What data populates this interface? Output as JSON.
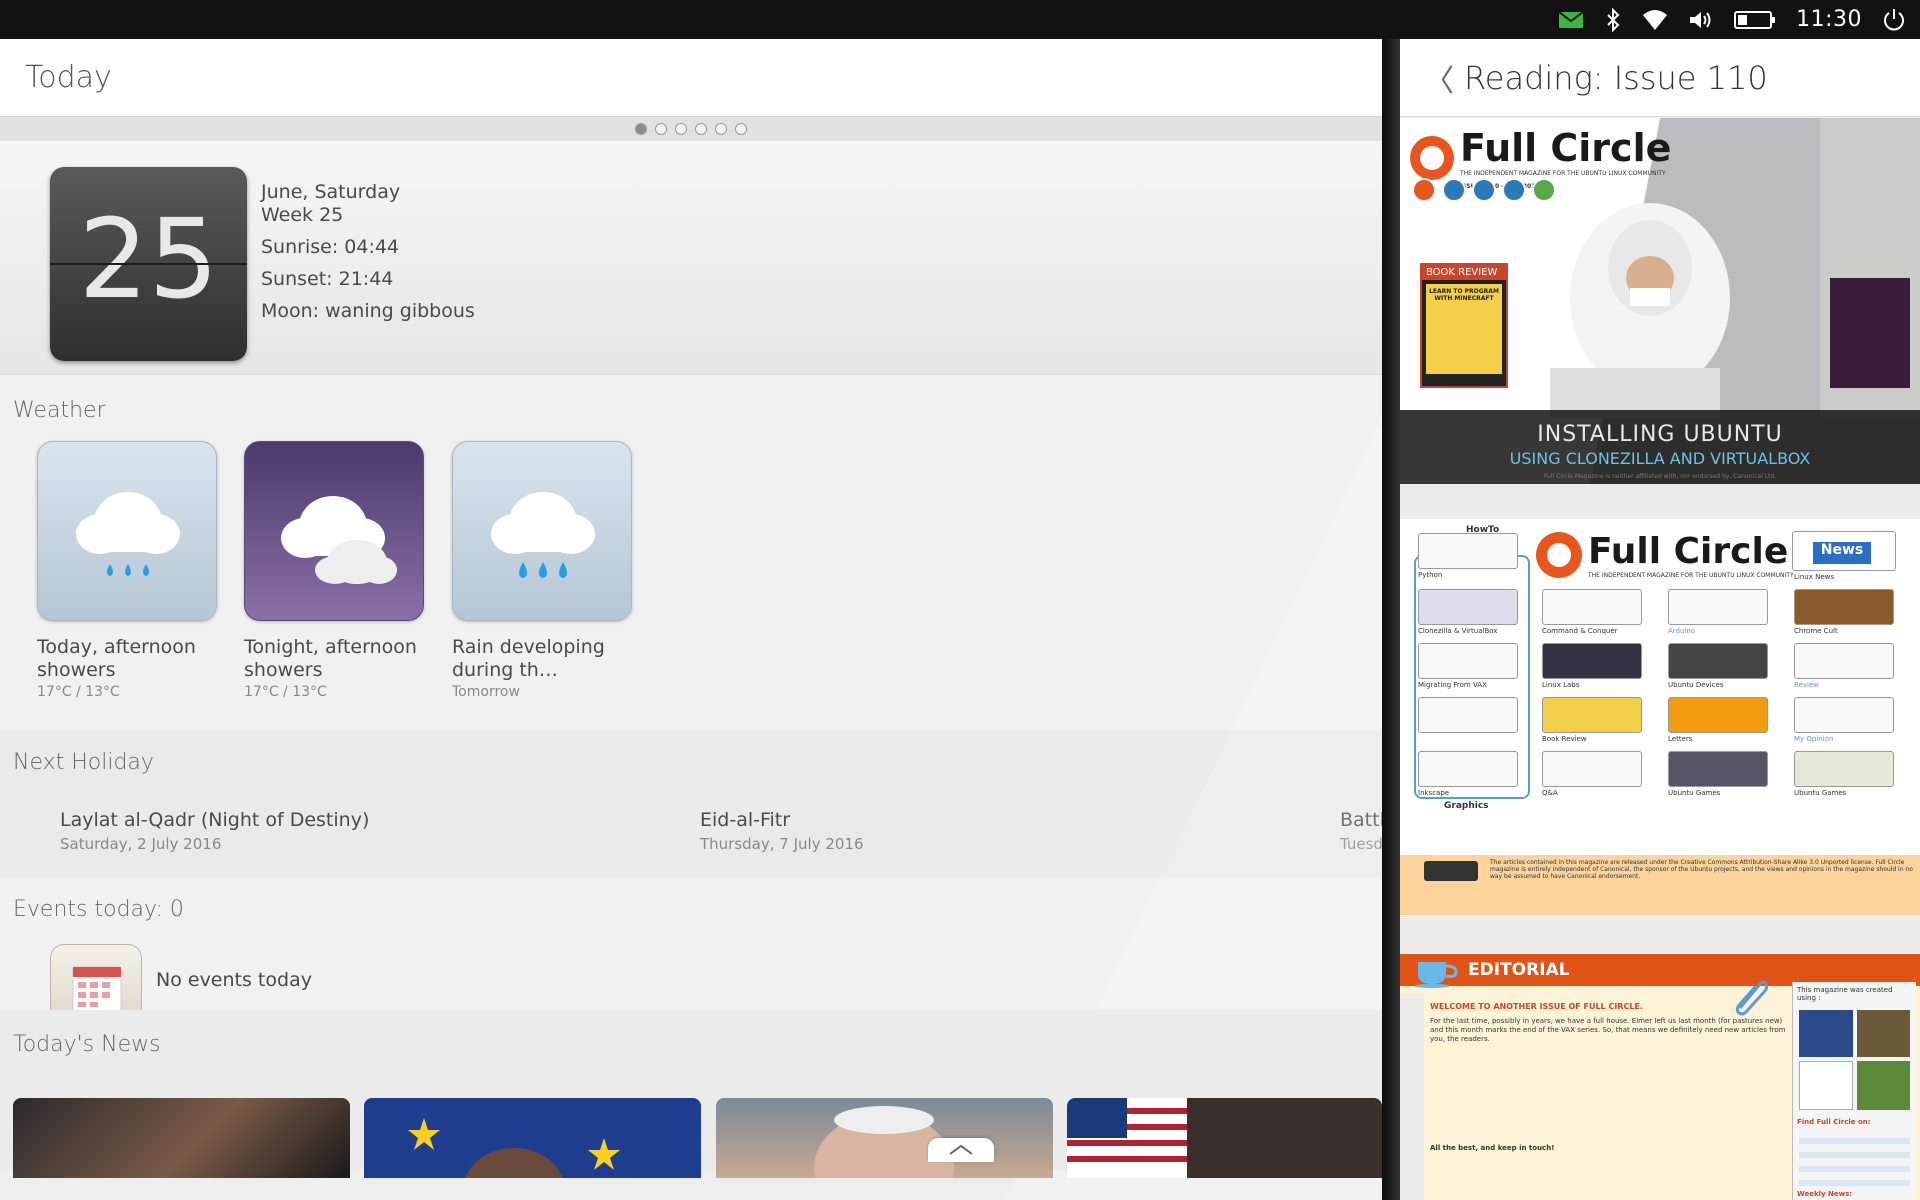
{
  "status": {
    "time": "11:30",
    "indicators": [
      "message-icon",
      "bluetooth-icon",
      "wifi-icon",
      "volume-icon",
      "battery-icon",
      "power-icon"
    ],
    "accent_message": "#3bb54a"
  },
  "today": {
    "title": "Today",
    "page_count": 6,
    "active_page": 0,
    "date": {
      "day_number": "25",
      "line1": "June, Saturday",
      "line2": "Week 25",
      "sunrise": "Sunrise: 04:44",
      "sunset": "Sunset: 21:44",
      "moon": "Moon: waning gibbous"
    },
    "weather": {
      "title": "Weather",
      "items": [
        {
          "icon": "rain-cloud-icon",
          "label": "Today, afternoon showers",
          "sub": "17°C / 13°C",
          "theme": "day"
        },
        {
          "icon": "cloud-icon",
          "label": "Tonight, afternoon showers",
          "sub": "17°C / 13°C",
          "theme": "night"
        },
        {
          "icon": "rain-cloud-icon",
          "label": "Rain developing during th…",
          "sub": "Tomorrow",
          "theme": "day"
        }
      ]
    },
    "holiday": {
      "title": "Next Holiday",
      "items": [
        {
          "name": "Laylat al-Qadr (Night of Destiny)",
          "date": "Saturday, 2 July 2016"
        },
        {
          "name": "Eid-al-Fitr",
          "date": "Thursday, 7 July 2016"
        },
        {
          "name": "Battle",
          "date": "Tuesday"
        }
      ]
    },
    "events": {
      "title": "Events today: 0",
      "empty": "No events today"
    },
    "news": {
      "title": "Today's News"
    }
  },
  "reader": {
    "back_label": "〈",
    "title": "Reading: Issue 110",
    "cover": {
      "magazine": "Full Circle",
      "tagline": "THE INDEPENDENT MAGAZINE FOR THE UBUNTU LINUX COMMUNITY",
      "issue": "ISSUE #110 - June 2016",
      "book_review": "BOOK REVIEW",
      "book_title": "LEARN TO PROGRAM WITH MINECRAFT",
      "headline": "INSTALLING UBUNTU",
      "subheadline": "USING CLONEZILLA AND VIRTUALBOX",
      "disclaimer": "Full Circle Magazine is neither affiliated with, nor endorsed by, Canonical Ltd."
    },
    "contents": {
      "magazine": "Full Circle",
      "tagline": "THE INDEPENDENT MAGAZINE FOR THE UBUNTU LINUX COMMUNITY",
      "howto": "HowTo",
      "graphics": "Graphics",
      "news": "News",
      "labels": [
        "Python",
        "Clonezilla & VirtualBox",
        "Migrating From VAX",
        "Inkscape",
        "Command & Conquer",
        "Linux Labs",
        "Book Review",
        "Q&A",
        "Arduino",
        "Ubuntu Devices",
        "Letters",
        "Ubuntu Games",
        "Linux News",
        "Chrome Cult",
        "Review",
        "My Opinion",
        "Ubuntu Games"
      ],
      "license": "The articles contained in this magazine are released under the Creative Commons Attribution-Share Alike 3.0 Unported license. Full Circle magazine is entirely independent of Canonical, the sponsor of the Ubuntu projects, and the views and opinions in the magazine should in no way be assumed to have Canonical endorsement."
    },
    "editorial": {
      "title": "EDITORIAL",
      "welcome": "WELCOME TO ANOTHER ISSUE OF FULL CIRCLE.",
      "body": "For the last time, possibly in years, we have a full house. Elmer left us last month (for pastures new) and this month marks the end of the VAX series. So, that means we definitely need new articles from you, the readers.",
      "signoff": "All the best, and keep in touch!",
      "created_using": "This magazine was created using :",
      "find": "Find Full Circle on:",
      "weekly": "Weekly News:"
    }
  }
}
